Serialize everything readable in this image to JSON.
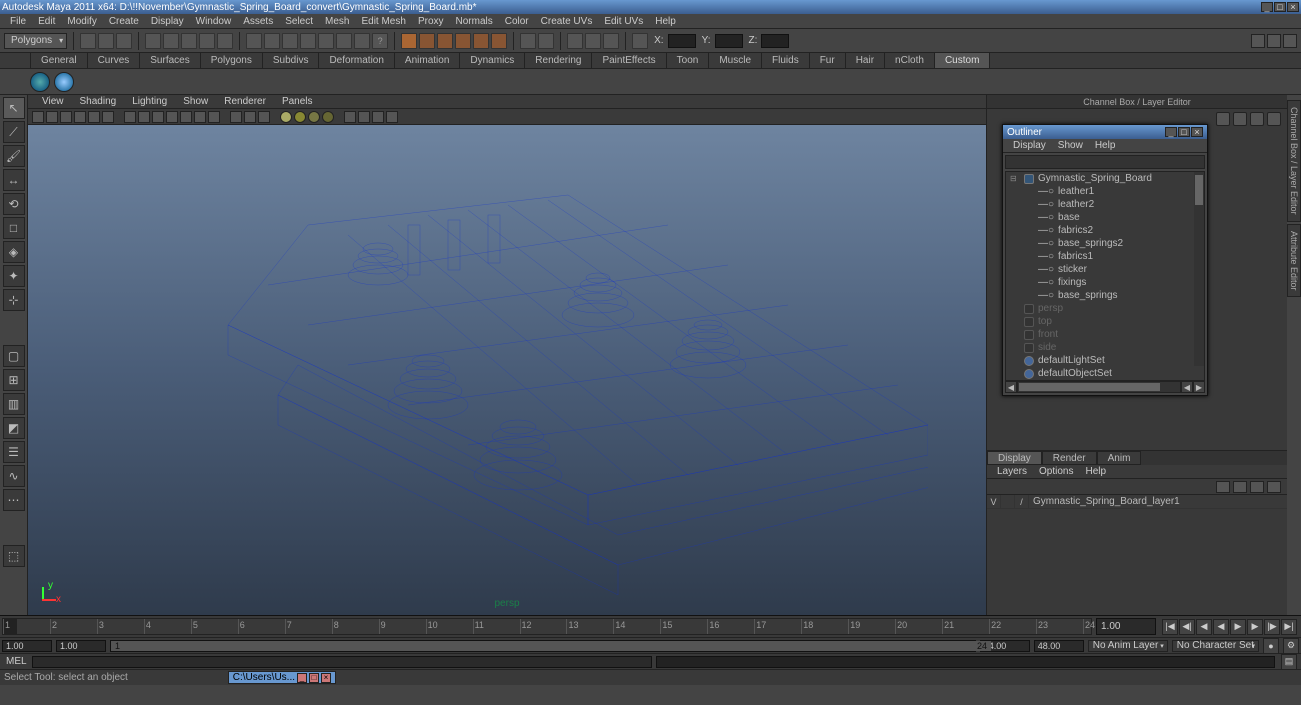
{
  "title": "Autodesk Maya 2011 x64: D:\\!!November\\Gymnastic_Spring_Board_convert\\Gymnastic_Spring_Board.mb*",
  "menubar": [
    "File",
    "Edit",
    "Modify",
    "Create",
    "Display",
    "Window",
    "Assets",
    "Select",
    "Mesh",
    "Edit Mesh",
    "Proxy",
    "Normals",
    "Color",
    "Create UVs",
    "Edit UVs",
    "Help"
  ],
  "mode_dropdown": "Polygons",
  "coords": {
    "x": "X:",
    "y": "Y:",
    "z": "Z:"
  },
  "shelf_tabs": [
    "General",
    "Curves",
    "Surfaces",
    "Polygons",
    "Subdivs",
    "Deformation",
    "Animation",
    "Dynamics",
    "Rendering",
    "PaintEffects",
    "Toon",
    "Muscle",
    "Fluids",
    "Fur",
    "Hair",
    "nCloth",
    "Custom"
  ],
  "shelf_active": "Custom",
  "viewport_menu": [
    "View",
    "Shading",
    "Lighting",
    "Show",
    "Renderer",
    "Panels"
  ],
  "viewport_label": "persp",
  "channelbox_title": "Channel Box / Layer Editor",
  "outliner": {
    "title": "Outliner",
    "menu": [
      "Display",
      "Show",
      "Help"
    ],
    "root": "Gymnastic_Spring_Board",
    "children": [
      "leather1",
      "leather2",
      "base",
      "fabrics2",
      "base_springs2",
      "fabrics1",
      "sticker",
      "fixings",
      "base_springs"
    ],
    "cameras": [
      "persp",
      "top",
      "front",
      "side"
    ],
    "sets": [
      "defaultLightSet",
      "defaultObjectSet"
    ]
  },
  "layers": {
    "tabs": [
      "Display",
      "Render",
      "Anim"
    ],
    "menu": [
      "Layers",
      "Options",
      "Help"
    ],
    "row": {
      "v": "V",
      "blank": "",
      "slash": "/",
      "name": "Gymnastic_Spring_Board_layer1"
    }
  },
  "right_tabs": [
    "Channel Box / Layer Editor",
    "Attribute Editor"
  ],
  "timeslider": {
    "ticks": [
      1,
      2,
      3,
      4,
      5,
      6,
      7,
      8,
      9,
      10,
      11,
      12,
      13,
      14,
      15,
      16,
      17,
      18,
      19,
      20,
      21,
      22,
      23,
      24
    ],
    "end": "1.00"
  },
  "range": {
    "start_outer": "1.00",
    "start_inner": "1.00",
    "handle_start": "1",
    "handle_end": "24",
    "end_inner": "24.00",
    "end_outer": "48.00"
  },
  "anim_layer_dd": "No Anim Layer",
  "char_set_dd": "No Character Set",
  "cmd_label": "MEL",
  "helpline": "Select Tool: select an object",
  "taskbar_item": "C:\\Users\\Us..."
}
